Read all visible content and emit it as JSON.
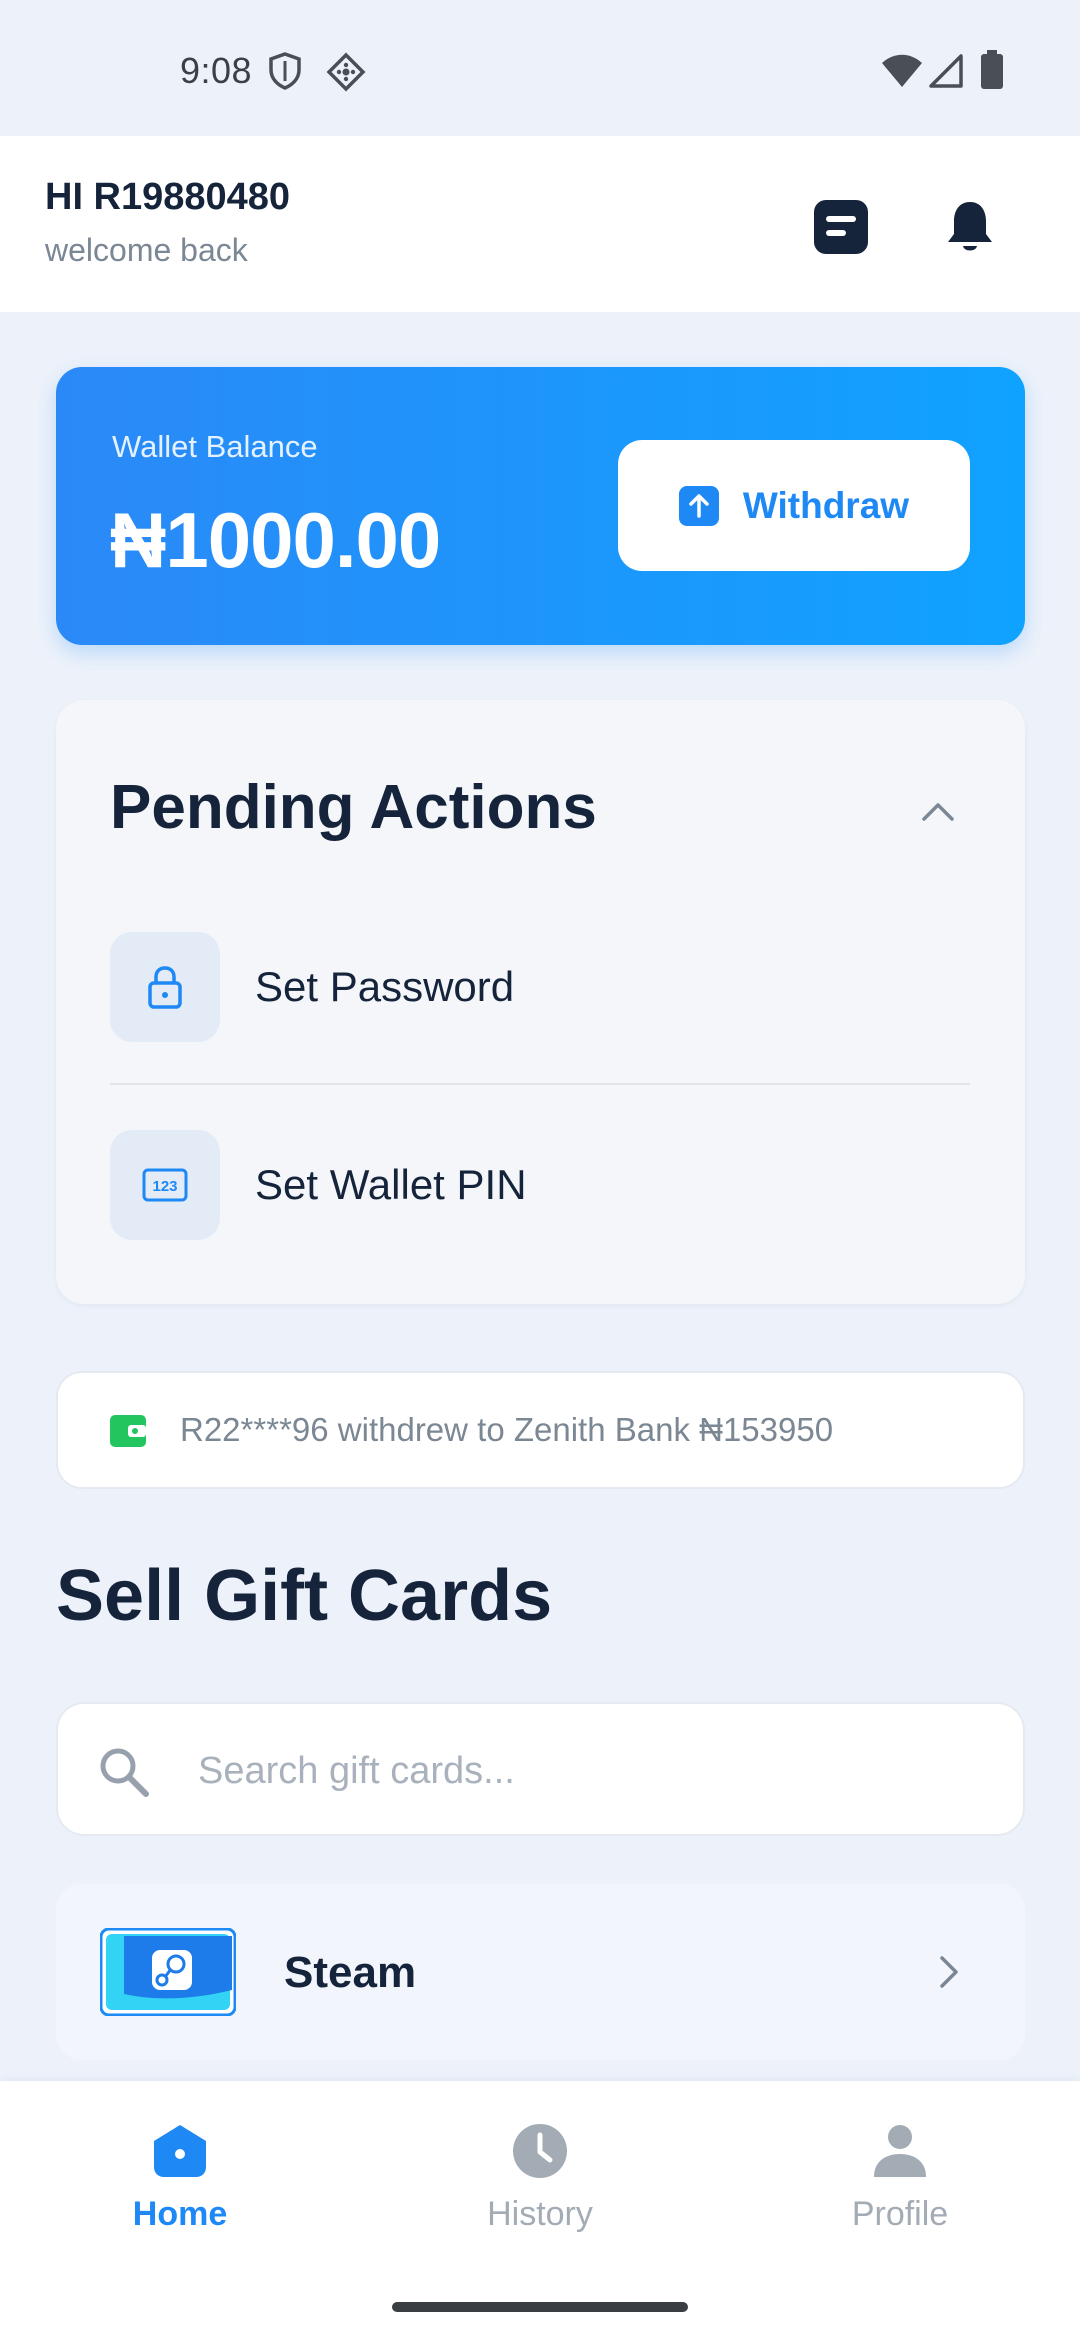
{
  "status_bar": {
    "time": "9:08"
  },
  "header": {
    "greeting": "HI R19880480",
    "subtitle": "welcome back"
  },
  "wallet": {
    "label": "Wallet Balance",
    "balance": "₦1000.00",
    "withdraw_label": "Withdraw"
  },
  "pending": {
    "title": "Pending Actions",
    "items": [
      {
        "label": "Set Password",
        "icon": "lock-icon"
      },
      {
        "label": "Set Wallet PIN",
        "icon": "pin-123-icon"
      }
    ]
  },
  "ticker": {
    "text": "R22****96 withdrew to Zenith Bank ₦153950",
    "icon": "wallet-icon"
  },
  "gift_cards": {
    "title": "Sell Gift Cards",
    "search_placeholder": "Search gift cards...",
    "items": [
      {
        "name": "Steam",
        "icon": "steam-logo"
      }
    ]
  },
  "nav": {
    "items": [
      {
        "label": "Home",
        "icon": "home-icon",
        "active": true
      },
      {
        "label": "History",
        "icon": "clock-icon",
        "active": false
      },
      {
        "label": "Profile",
        "icon": "person-icon",
        "active": false
      }
    ]
  },
  "colors": {
    "accent": "#1e88f5",
    "background": "#edf2fa",
    "text_dark": "#15243b",
    "text_muted": "#7b8794",
    "ticker_icon": "#22c55e"
  }
}
